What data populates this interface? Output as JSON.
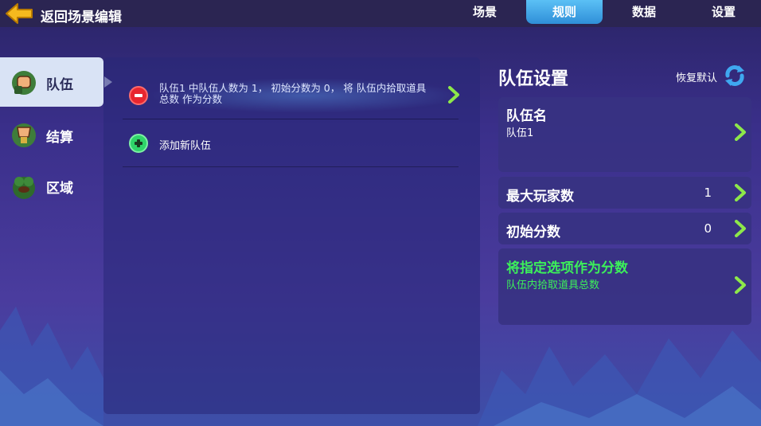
{
  "topbar": {
    "back_label": "返回场景编辑",
    "tabs": [
      {
        "label": "场景",
        "active": false
      },
      {
        "label": "规则",
        "active": true
      },
      {
        "label": "数据",
        "active": false
      },
      {
        "label": "设置",
        "active": false
      }
    ]
  },
  "sidebar": {
    "items": [
      {
        "label": "队伍",
        "icon": "team-fist-icon",
        "active": true
      },
      {
        "label": "结算",
        "icon": "settlement-trophy-icon",
        "active": false
      },
      {
        "label": "区域",
        "icon": "zone-bush-icon",
        "active": false
      }
    ]
  },
  "middle": {
    "teams": [
      {
        "text": "队伍1 中队伍人数为 1， 初始分数为 0， 将 队伍内拾取道具总数 作为分数"
      }
    ],
    "add_label": "添加新队伍"
  },
  "right": {
    "title": "队伍设置",
    "restore_label": "恢复默认",
    "team_name": {
      "label": "队伍名",
      "value": "队伍1"
    },
    "max_players": {
      "label": "最大玩家数",
      "value": "1"
    },
    "initial_score": {
      "label": "初始分数",
      "value": "0"
    },
    "score_option": {
      "label": "将指定选项作为分数",
      "value": "队伍内拾取道具总数"
    }
  },
  "colors": {
    "accent_blue": "#2f8fd8",
    "highlight_green": "#3cf05a",
    "remove_red": "#e8262f",
    "add_green": "#2fd46a"
  }
}
